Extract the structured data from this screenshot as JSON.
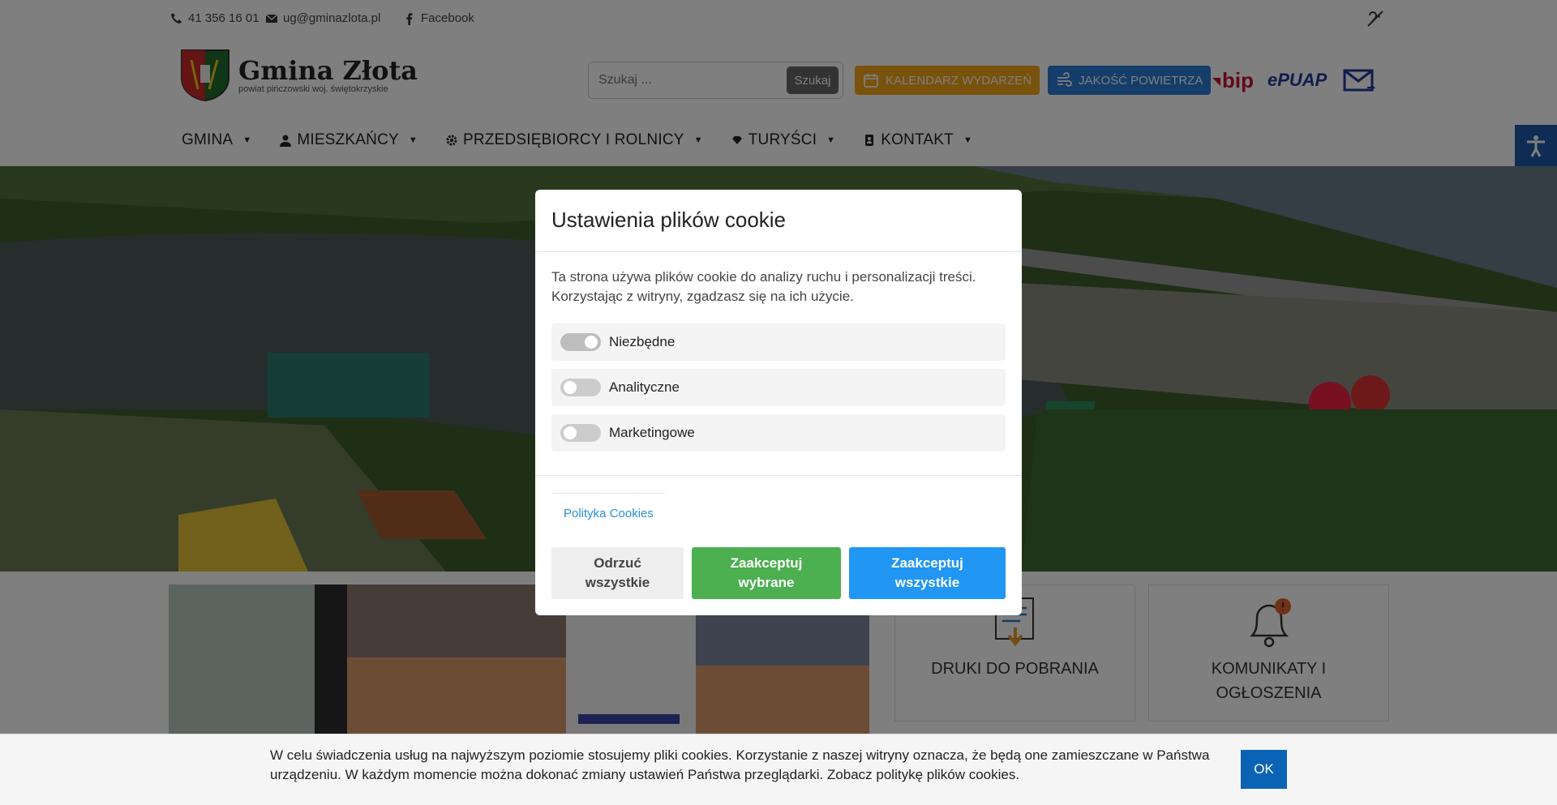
{
  "topbar": {
    "phone": "41 356 16 01",
    "email": "ug@gminazlota.pl",
    "facebook": "Facebook"
  },
  "logo": {
    "title": "Gmina Złota",
    "subtitle": "powiat pińczowski woj. świętokrzyskie"
  },
  "search": {
    "placeholder": "Szukaj ...",
    "button": "Szukaj"
  },
  "header_buttons": {
    "calendar": "KALENDARZ WYDARZEŃ",
    "air": "JAKOŚĆ POWIETRZA",
    "bip": "bip",
    "epuap": "ePUAP"
  },
  "nav": {
    "items": [
      {
        "label": "GMINA"
      },
      {
        "label": "MIESZKAŃCY"
      },
      {
        "label": "PRZEDSIĘBIORCY I ROLNICY"
      },
      {
        "label": "TURYŚCI"
      },
      {
        "label": "KONTAKT"
      }
    ]
  },
  "tiles": {
    "druki": "DRUKI DO POBRANIA",
    "komunikaty_line1": "KOMUNIKATY I",
    "komunikaty_line2": "OGŁOSZENIA"
  },
  "modal": {
    "title": "Ustawienia plików cookie",
    "description": "Ta strona używa plików cookie do analizy ruchu i personalizacji treści. Korzystając z witryny, zgadzasz się na ich użycie.",
    "options": [
      {
        "label": "Niezbędne",
        "enabled": true
      },
      {
        "label": "Analityczne",
        "enabled": false
      },
      {
        "label": "Marketingowe",
        "enabled": false
      }
    ],
    "policy_link": "Polityka Cookies",
    "reject_line1": "Odrzuć",
    "reject_line2": "wszystkie",
    "accept_selected_line1": "Zaakceptuj",
    "accept_selected_line2": "wybrane",
    "accept_all_line1": "Zaakceptuj",
    "accept_all_line2": "wszystkie"
  },
  "cookie_bar": {
    "text": "W celu świadczenia usług na najwyższym poziomie stosujemy pliki cookies. Korzystanie z naszej witryny oznacza, że będą one zamieszczane w Państwa urządzeniu. W każdym momencie można dokonać zmiany ustawień Państwa przeglądarki. Zobacz politykę plików cookies.",
    "ok": "OK"
  },
  "colors": {
    "calendar": "#f2a516",
    "air": "#2a7bd4",
    "accept_selected": "#4caf50",
    "accept_all": "#2196f3",
    "reject": "#eeeeee",
    "ok": "#0b63b5"
  }
}
